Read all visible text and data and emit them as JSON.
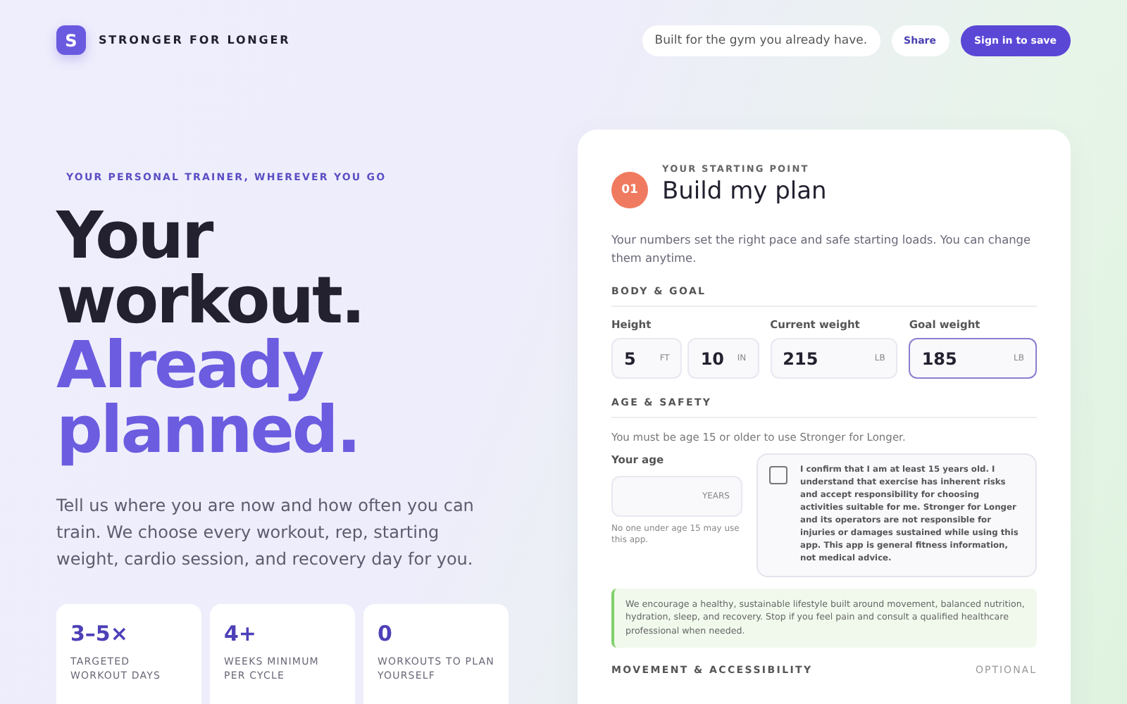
{
  "brand": {
    "logo_letter": "S",
    "name": "STRONGER FOR LONGER"
  },
  "header": {
    "tagline": "Built for the gym you already have.",
    "buttons": [
      {
        "label": "Share",
        "kind": "secondary"
      },
      {
        "label": "Sign in to save",
        "kind": "primary"
      }
    ]
  },
  "hero": {
    "eyebrow": "YOUR PERSONAL TRAINER, WHEREVER YOU GO",
    "headline": [
      {
        "text": "Your",
        "accent": false
      },
      {
        "text": "workout.",
        "accent": false
      },
      {
        "text": "Already",
        "accent": true
      },
      {
        "text": "planned.",
        "accent": true
      }
    ],
    "intro": "Tell us where you are now and how often you can train. We choose every workout, rep, starting weight, cardio session, and recovery day for you.",
    "stats": [
      {
        "value": "3–5×",
        "label": "TARGETED WORKOUT DAYS"
      },
      {
        "value": "4+",
        "label": "WEEKS MINIMUM PER CYCLE"
      },
      {
        "value": "0",
        "label": "WORKOUTS TO PLAN YOURSELF"
      }
    ]
  },
  "plan_card": {
    "step": "01",
    "eyebrow": "YOUR STARTING POINT",
    "title": "Build my plan",
    "intro": "Your numbers set the right pace and safe starting loads. You can change them anytime.",
    "body_goal": {
      "heading": "BODY & GOAL",
      "groups": [
        {
          "label": "Height",
          "fields": [
            {
              "value": "5",
              "unit": "FT",
              "focused": false
            },
            {
              "value": "10",
              "unit": "IN",
              "focused": false
            }
          ]
        },
        {
          "label": "Current weight",
          "fields": [
            {
              "value": "215",
              "unit": "LB",
              "focused": false
            }
          ]
        },
        {
          "label": "Goal weight",
          "fields": [
            {
              "value": "185",
              "unit": "LB",
              "focused": true
            }
          ]
        }
      ]
    },
    "age_safety": {
      "heading": "AGE & SAFETY",
      "note": "You must be age 15 or older to use Stronger for Longer.",
      "age_label": "Your age",
      "age_unit": "YEARS",
      "age_hint": "No one under age 15 may use this app.",
      "consent": {
        "checked": false,
        "text": "I confirm that I am at least 15 years old. I understand that exercise has inherent risks and accept responsibility for choosing activities suitable for me. Stronger for Longer and its operators are not responsible for injuries or damages sustained while using this app. This app is general fitness information, not medical advice."
      }
    },
    "wellness_note": "We encourage a healthy, sustainable lifestyle built around movement, balanced nutrition, hydration, sleep, and recovery. Stop if you feel pain and consult a qualified healthcare professional when needed.",
    "movement": {
      "heading": "MOVEMENT & ACCESSIBILITY",
      "tag": "OPTIONAL"
    }
  }
}
